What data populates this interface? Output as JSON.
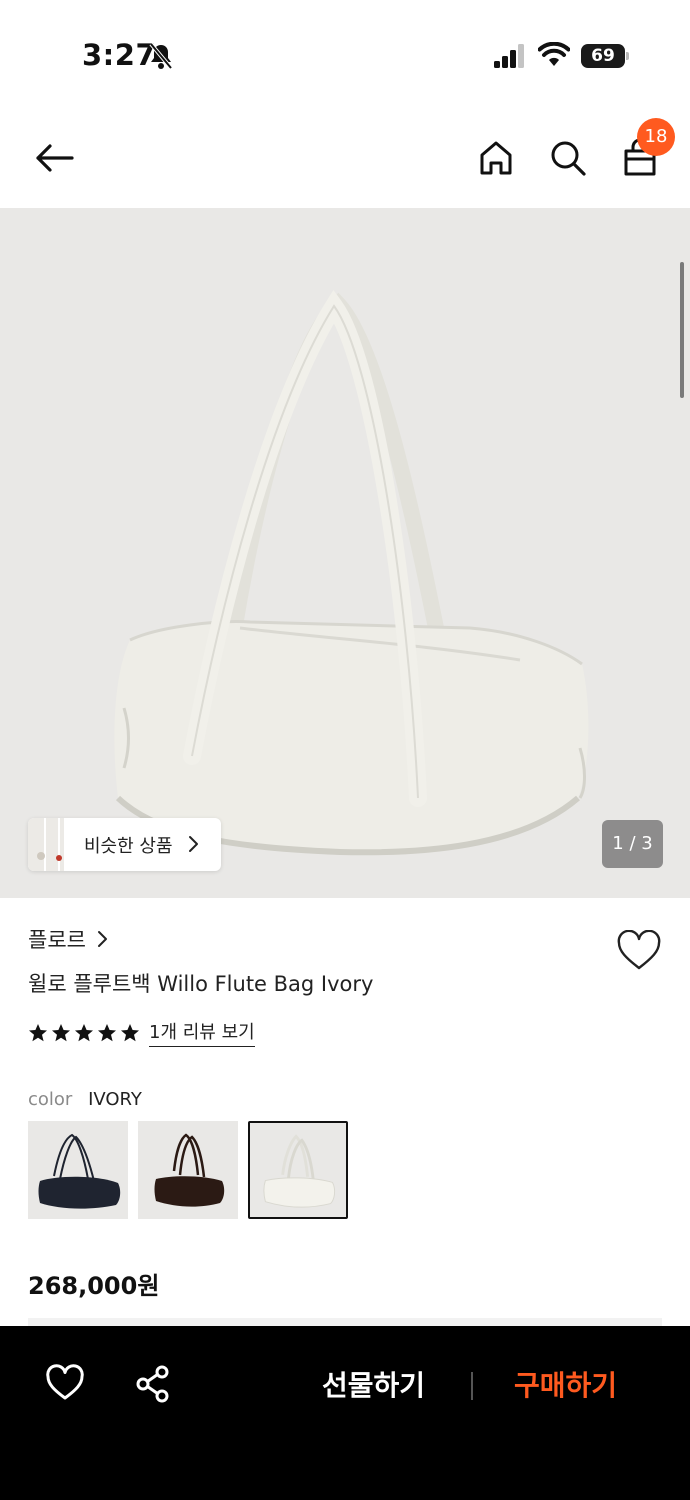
{
  "status_bar": {
    "time": "3:27",
    "battery": "69",
    "battery_level": 0.69
  },
  "nav": {
    "cart_count": "18"
  },
  "hero": {
    "similar_label": "비슷한 상품",
    "page_counter": "1 / 3"
  },
  "product": {
    "brand": "플로르",
    "title": "윌로 플루트백 Willo Flute Bag Ivory",
    "rating": 5,
    "review_link": "1개 리뷰 보기",
    "color_label": "color",
    "color_value": "IVORY",
    "swatches": [
      {
        "name": "navy",
        "color": "#1f2430"
      },
      {
        "name": "brown",
        "color": "#2b1a14"
      },
      {
        "name": "ivory",
        "color": "#eeeee8",
        "selected": true
      }
    ],
    "price": "268,000원"
  },
  "bottom_bar": {
    "gift_label": "선물하기",
    "buy_label": "구매하기"
  },
  "colors": {
    "accent": "#ff5a1f",
    "hero_bg": "#e9e8e6",
    "bag": "#eeede7"
  }
}
